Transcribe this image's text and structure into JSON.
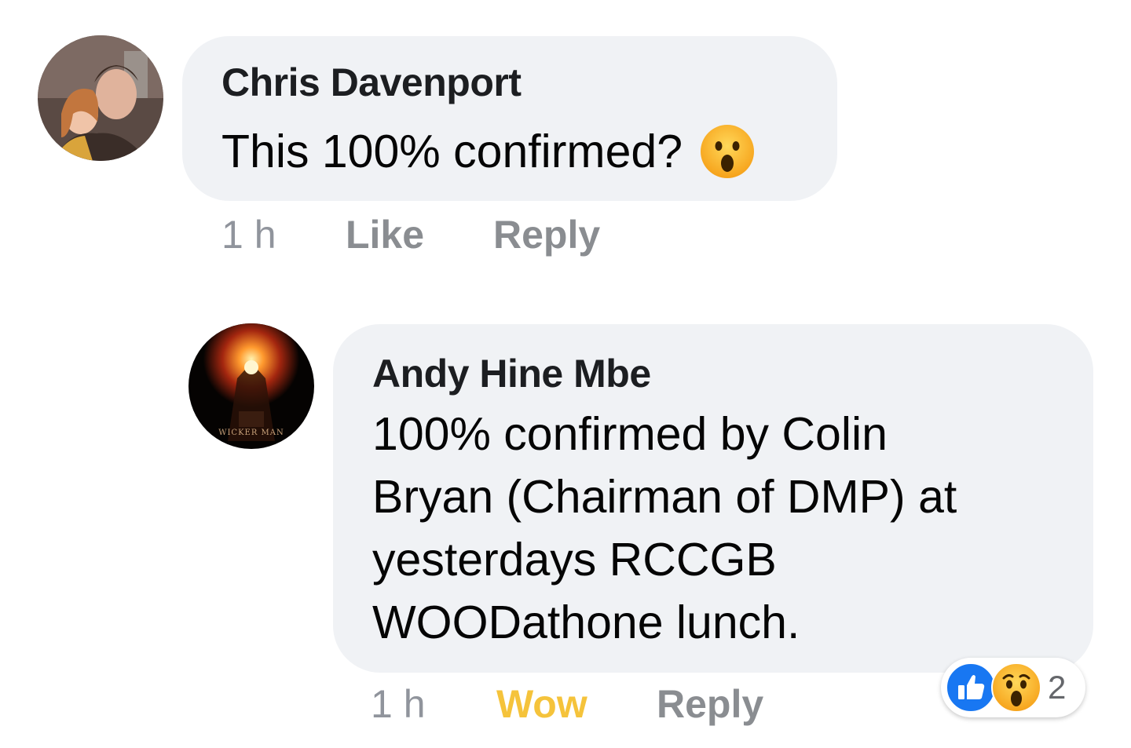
{
  "comments": [
    {
      "author": "Chris Davenport",
      "text": "This 100% confirmed?",
      "text_emoji": "wow-emoji-icon",
      "time": "1 h",
      "like_label": "Like",
      "reply_label": "Reply",
      "avatar": "profile-photo-avatar"
    },
    {
      "author": "Andy Hine Mbe",
      "text_lines": [
        "100% confirmed by Colin",
        "Bryan (Chairman of DMP) at",
        "yesterdays RCCGB",
        "WOODathone lunch."
      ],
      "time": "1 h",
      "reaction_label": "Wow",
      "reply_label": "Reply",
      "avatar": "wicker-man-poster-avatar",
      "reactions": {
        "icons": [
          "like-reaction-icon",
          "wow-reaction-icon"
        ],
        "count": "2"
      }
    }
  ],
  "colors": {
    "bubble": "#f0f2f5",
    "author": "#1c1e21",
    "meta": "#8a8d91",
    "wow": "#f5c33b",
    "like_blue": "#1877f2"
  }
}
